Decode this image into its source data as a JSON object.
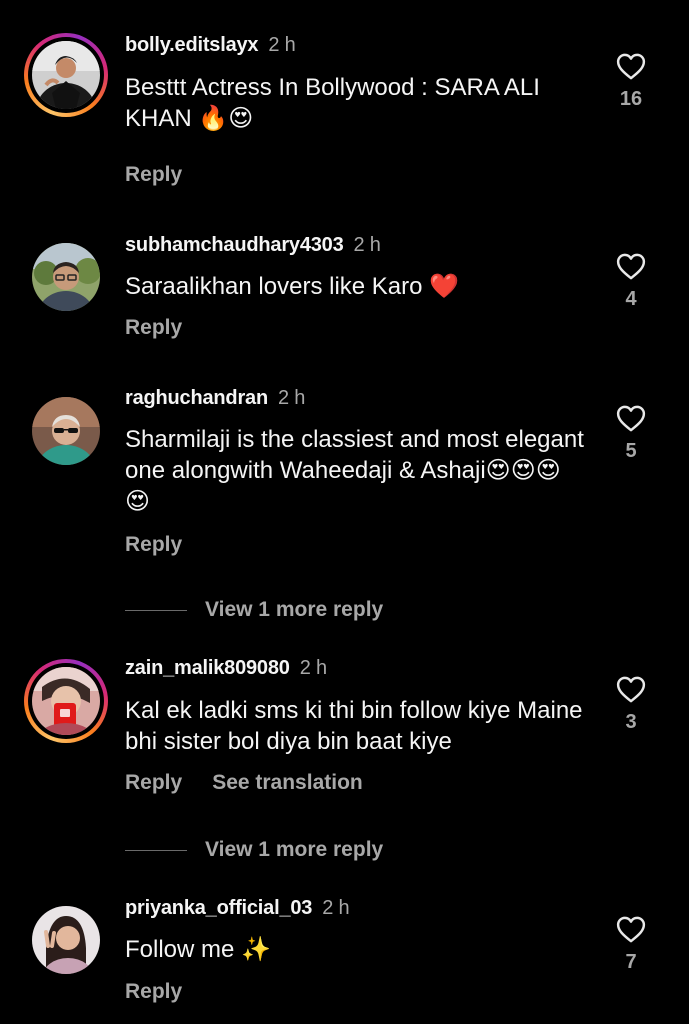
{
  "comments": [
    {
      "username": "bolly.editslayx",
      "time": "2 h",
      "text": "Besttt Actress In Bollywood : SARA ALI KHAN 🔥😍",
      "likes": "16",
      "reply": "Reply",
      "avatar_icon": "man-in-black-jacket-avatar"
    },
    {
      "username": "subhamchaudhary4303",
      "time": "2 h",
      "text": "Saraalikhan lovers like Karo ❤️",
      "likes": "4",
      "reply": "Reply",
      "avatar_icon": "man-with-glasses-avatar"
    },
    {
      "username": "raghuchandran",
      "time": "2 h",
      "text": "Sharmilaji is the classiest and most elegant one alongwith Waheedaji & Ashaji😍😍😍😍",
      "likes": "5",
      "reply": "Reply",
      "view_more": "View 1 more reply",
      "avatar_icon": "man-with-sunglasses-avatar"
    },
    {
      "username": "zain_malik809080",
      "time": "2 h",
      "text": "Kal ek ladki sms ki thi bin follow kiye Maine bhi sister bol diya bin baat kiye",
      "likes": "3",
      "reply": "Reply",
      "see_translation": "See translation",
      "view_more": "View 1 more reply",
      "avatar_icon": "person-with-red-phone-avatar"
    },
    {
      "username": "priyanka_official_03",
      "time": "2 h",
      "text": "Follow me ✨",
      "likes": "7",
      "reply": "Reply",
      "avatar_icon": "woman-peace-sign-avatar"
    }
  ],
  "colors": {
    "background": "#000000",
    "text": "#f5f5f5",
    "muted": "#a8a8a8"
  }
}
